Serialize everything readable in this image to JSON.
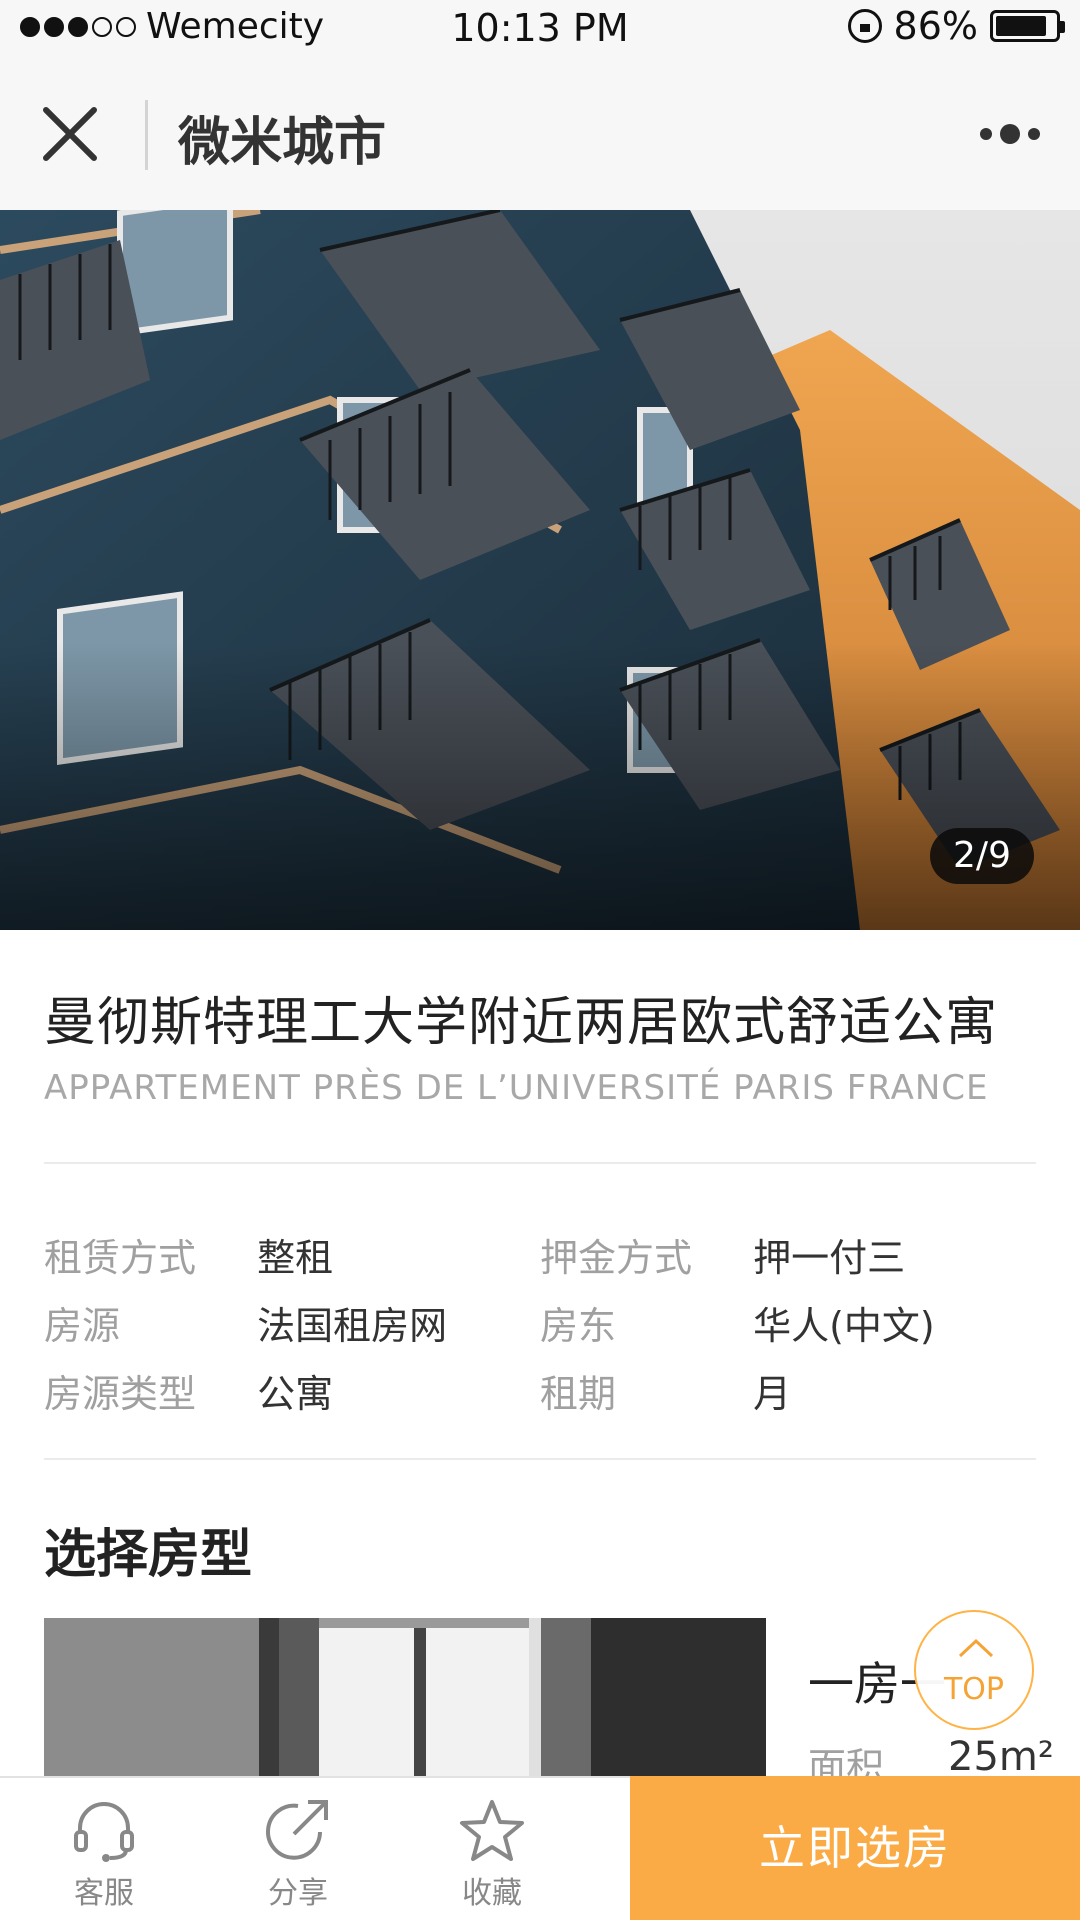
{
  "status_bar": {
    "carrier": "Wemecity",
    "time": "10:13 PM",
    "battery": "86%",
    "signal_bars_filled": 3,
    "signal_bars_total": 5
  },
  "nav": {
    "title": "微米城市",
    "close_icon": "close-icon",
    "more_icon": "more-icon"
  },
  "gallery": {
    "counter": "2/9"
  },
  "listing": {
    "title_cn": "曼彻斯特理工大学附近两居欧式舒适公寓",
    "title_fr": "APPARTEMENT PRÈS DE L’UNIVERSITÉ PARIS FRANCE",
    "details": [
      {
        "label": "租赁方式",
        "value": "整租",
        "label2": "押金方式",
        "value2": "押一付三"
      },
      {
        "label": "房源",
        "value": "法国租房网",
        "label2": "房东",
        "value2": "华人(中文)"
      },
      {
        "label": "房源类型",
        "value": "公寓",
        "label2": "租期",
        "value2": "月"
      }
    ]
  },
  "room_section": {
    "title": "选择房型",
    "room_name": "一房一",
    "area_label": "面积",
    "area_value": "25m²"
  },
  "top_button": {
    "label": "TOP"
  },
  "bottom_bar": {
    "tabs": [
      {
        "label": "客服",
        "icon": "headset-icon"
      },
      {
        "label": "分享",
        "icon": "share-icon"
      },
      {
        "label": "收藏",
        "icon": "star-icon"
      }
    ],
    "cta": "立即选房"
  },
  "colors": {
    "accent": "#fbab45",
    "nav_bg": "#f7f7f7"
  }
}
